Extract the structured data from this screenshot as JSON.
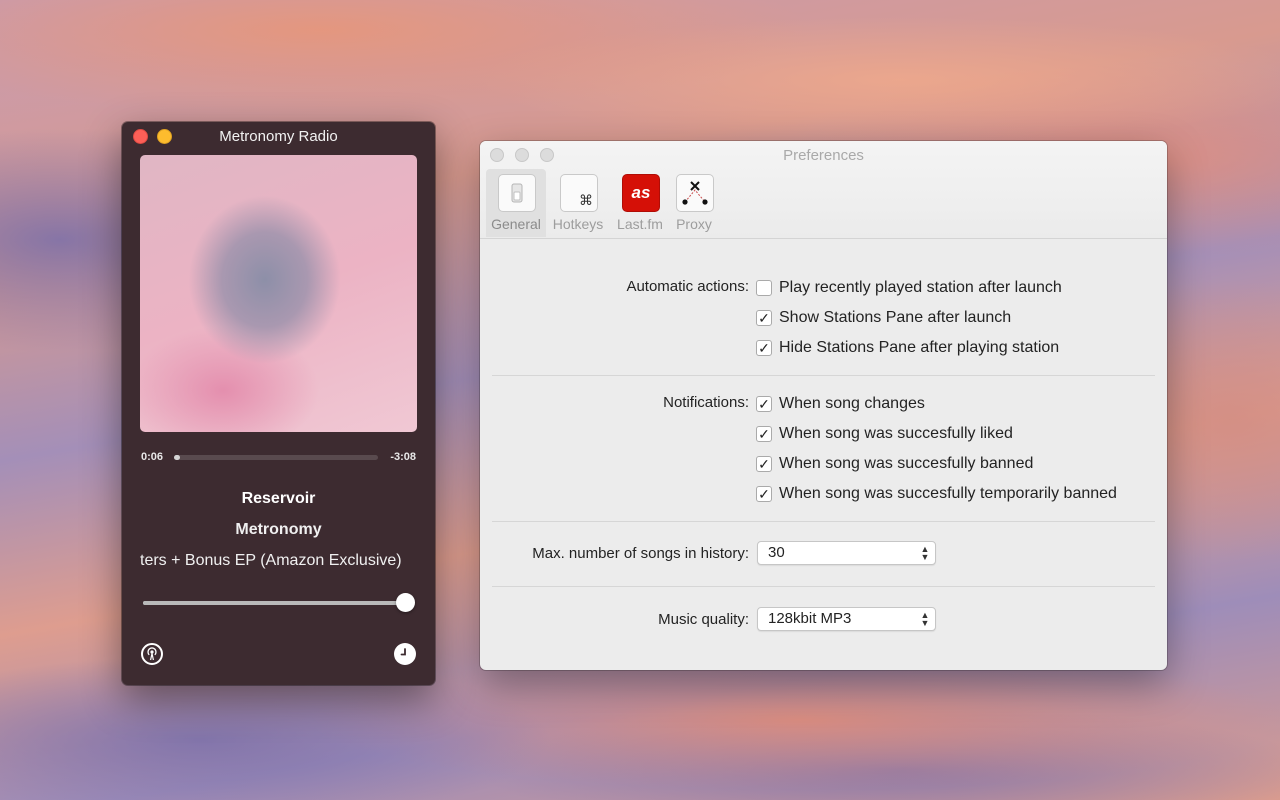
{
  "player": {
    "title": "Metronomy Radio",
    "elapsed": "0:06",
    "remaining": "-3:08",
    "progress_percent": 3,
    "song": "Reservoir",
    "artist": "Metronomy",
    "album": "ters + Bonus EP (Amazon Exclusive)",
    "volume_percent": 100
  },
  "prefs": {
    "title": "Preferences",
    "tabs": [
      {
        "label": "General",
        "icon": "switch-icon"
      },
      {
        "label": "Hotkeys",
        "icon": "command-key-icon"
      },
      {
        "label": "Last.fm",
        "icon": "lastfm-icon"
      },
      {
        "label": "Proxy",
        "icon": "proxy-icon"
      }
    ],
    "automatic_label": "Automatic actions:",
    "automatic": [
      {
        "label": "Play recently played station after launch",
        "checked": false
      },
      {
        "label": "Show Stations Pane after launch",
        "checked": true
      },
      {
        "label": "Hide Stations Pane after playing station",
        "checked": true
      }
    ],
    "notifications_label": "Notifications:",
    "notifications": [
      {
        "label": "When song changes",
        "checked": true
      },
      {
        "label": "When song was succesfully liked",
        "checked": true
      },
      {
        "label": "When song was succesfully banned",
        "checked": true
      },
      {
        "label": "When song was succesfully temporarily banned",
        "checked": true
      }
    ],
    "history_label": "Max. number of songs in history:",
    "history_value": "30",
    "quality_label": "Music quality:",
    "quality_value": "128kbit MP3",
    "check_glyph": "✓",
    "lastfm_glyph": "as"
  }
}
